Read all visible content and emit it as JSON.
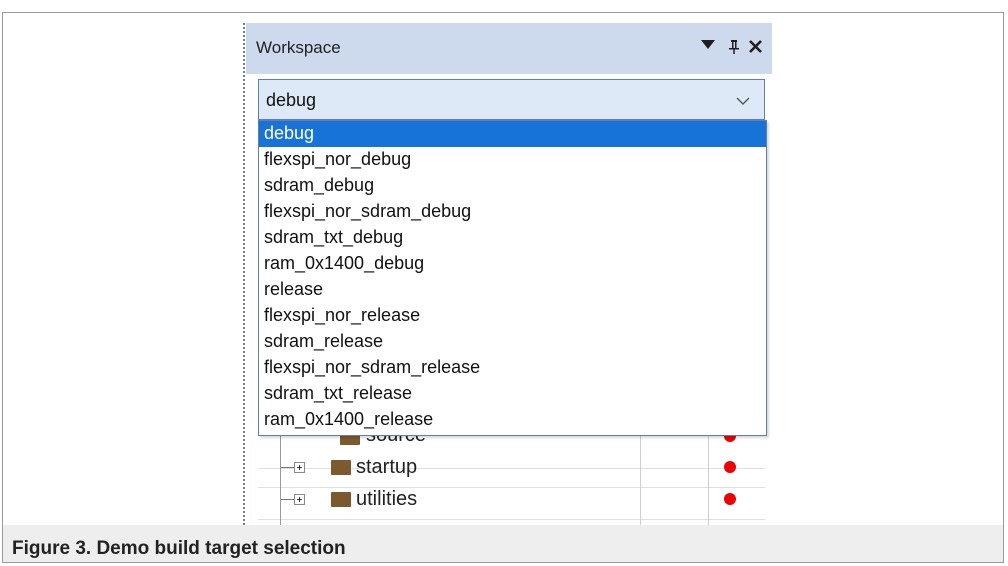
{
  "workspace": {
    "title": "Workspace",
    "icons": {
      "menu": "dropdown-arrow-icon",
      "pin": "pin-icon",
      "close": "close-icon"
    }
  },
  "combo": {
    "selected": "debug",
    "options": [
      "debug",
      "flexspi_nor_debug",
      "sdram_debug",
      "flexspi_nor_sdram_debug",
      "sdram_txt_debug",
      "ram_0x1400_debug",
      "release",
      "flexspi_nor_release",
      "sdram_release",
      "flexspi_nor_sdram_release",
      "sdram_txt_release",
      "ram_0x1400_release"
    ]
  },
  "tree": {
    "items": [
      {
        "label": "source"
      },
      {
        "label": "startup"
      },
      {
        "label": "utilities"
      }
    ]
  },
  "colors": {
    "selection": "#1773d8",
    "titlebar": "#cdd9ec",
    "status_dot": "#ee0000",
    "folder": "#7c5a2e"
  },
  "caption": "Figure 3.  Demo build target selection"
}
